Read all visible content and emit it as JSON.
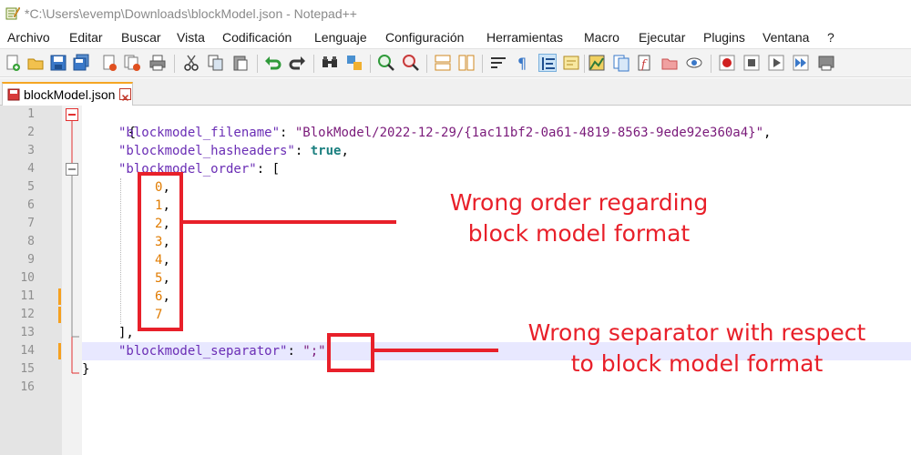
{
  "window": {
    "title": "*C:\\Users\\evemp\\Downloads\\blockModel.json - Notepad++"
  },
  "menu": {
    "items": [
      "Archivo",
      "Editar",
      "Buscar",
      "Vista",
      "Codificación",
      "Lenguaje",
      "Configuración",
      "Herramientas",
      "Macro",
      "Ejecutar",
      "Plugins",
      "Ventana",
      "?"
    ]
  },
  "toolbar": {
    "buttons": [
      "new-file-icon",
      "open-file-icon",
      "save-icon",
      "save-all-icon",
      "close-icon",
      "close-all-icon",
      "print-icon",
      "cut-icon",
      "copy-icon",
      "paste-icon",
      "undo-icon",
      "redo-icon",
      "find-icon",
      "replace-icon",
      "zoom-in-icon",
      "zoom-out-icon",
      "sync-vertical-icon",
      "sync-horizontal-icon",
      "word-wrap-icon",
      "show-all-chars-icon",
      "indent-guide-icon",
      "language-icon",
      "document-map-icon",
      "document-list-icon",
      "function-list-icon",
      "folder-workspace-icon",
      "monitoring-icon",
      "record-macro-icon",
      "stop-macro-icon",
      "play-macro-icon",
      "run-macro-multiple-icon",
      "save-macro-icon"
    ]
  },
  "tab": {
    "label": "blockModel.json"
  },
  "editor": {
    "line_numbers": [
      "1",
      "2",
      "3",
      "4",
      "5",
      "6",
      "7",
      "8",
      "9",
      "10",
      "11",
      "12",
      "13",
      "14",
      "15",
      "16"
    ],
    "lines": {
      "l1_brace": "{",
      "l2_key": "\"blockmodel_filename\"",
      "l2_colon": ": ",
      "l2_value": "\"BlokModel/2022-12-29/{1ac11bf2-0a61-4819-8563-9ede92e360a4}\"",
      "l2_comma": ",",
      "l3_key": "\"blockmodel_hasheaders\"",
      "l3_colon": ": ",
      "l3_value": "true",
      "l3_comma": ",",
      "l4_key": "\"blockmodel_order\"",
      "l4_rest": ": [",
      "order_values": [
        "0",
        "1",
        "2",
        "3",
        "4",
        "5",
        "6",
        "7"
      ],
      "l13_close": "],",
      "l14_key": "\"blockmodel_separator\"",
      "l14_colon": ": ",
      "l14_value": "\";\"",
      "l15_brace": "}"
    }
  },
  "annotations": {
    "order_note_line1": "Wrong order regarding",
    "order_note_line2": "block model format",
    "separator_note_line1": "Wrong separator with respect",
    "separator_note_line2": "to block model format"
  },
  "colors": {
    "annotation": "#e8202a",
    "json_key": "#6a2db5",
    "json_number": "#e07b00",
    "json_bool": "#1a7f7f",
    "change_marker": "#f5a020"
  }
}
